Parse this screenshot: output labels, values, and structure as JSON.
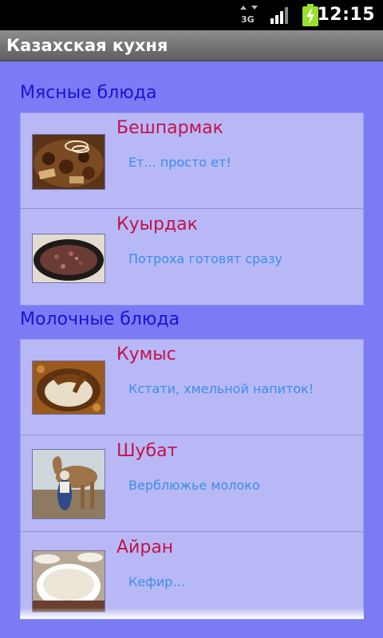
{
  "status_bar": {
    "network": "3G",
    "time": "12:15",
    "icons": [
      "data-3g-icon",
      "signal-icon",
      "battery-charging-icon"
    ]
  },
  "app": {
    "title": "Казахская кухня"
  },
  "sections": [
    {
      "header": "Мясные блюда",
      "items": [
        {
          "name": "Бешпармак",
          "description": "Ет... просто ет!",
          "image_icon": "beshbarmak-photo"
        },
        {
          "name": "Куырдак",
          "description": "Потроха готовят сразу",
          "image_icon": "kuyrdak-photo"
        }
      ]
    },
    {
      "header": "Молочные блюда",
      "items": [
        {
          "name": "Кумыс",
          "description": "Кстати, хмельной напиток!",
          "image_icon": "kumys-photo"
        },
        {
          "name": "Шубат",
          "description": "Верблюжье молоко",
          "image_icon": "shubat-photo"
        },
        {
          "name": "Айран",
          "description": "Кефир...",
          "image_icon": "ayran-photo"
        }
      ]
    }
  ],
  "colors": {
    "background": "#7b7cf5",
    "card": "#b8b8f6",
    "section_header": "#1a13d3",
    "dish_name": "#c3124b",
    "dish_description": "#3b8fe8"
  }
}
